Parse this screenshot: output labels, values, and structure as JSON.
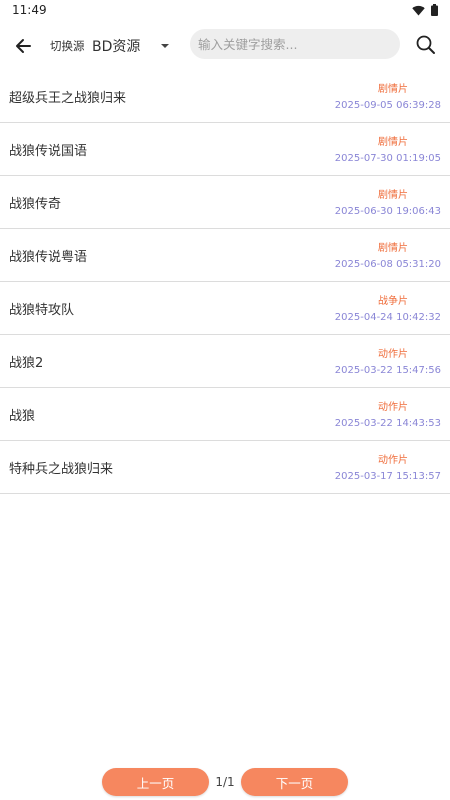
{
  "status_bar": {
    "time": "11:49",
    "icons": [
      "wifi-icon",
      "battery-icon"
    ]
  },
  "toolbar": {
    "switch_label": "切换源",
    "source_value": "BD资源",
    "search_placeholder": "输入关键字搜索...",
    "search_value": ""
  },
  "results": [
    {
      "title": "超级兵王之战狼归来",
      "genre": "剧情片",
      "date": "2025-09-05 06:39:28"
    },
    {
      "title": "战狼传说国语",
      "genre": "剧情片",
      "date": "2025-07-30 01:19:05"
    },
    {
      "title": "战狼传奇",
      "genre": "剧情片",
      "date": "2025-06-30 19:06:43"
    },
    {
      "title": "战狼传说粤语",
      "genre": "剧情片",
      "date": "2025-06-08 05:31:20"
    },
    {
      "title": "战狼特攻队",
      "genre": "战争片",
      "date": "2025-04-24 10:42:32"
    },
    {
      "title": "战狼2",
      "genre": "动作片",
      "date": "2025-03-22 15:47:56"
    },
    {
      "title": "战狼",
      "genre": "动作片",
      "date": "2025-03-22 14:43:53"
    },
    {
      "title": "特种兵之战狼归来",
      "genre": "动作片",
      "date": "2025-03-17 15:13:57"
    }
  ],
  "pagination": {
    "prev_label": "上一页",
    "page_info": "1/1",
    "next_label": "下一页"
  },
  "colors": {
    "accent": "#f6875f",
    "genre_text": "#ef6c3a",
    "date_text": "#8a86d6"
  }
}
